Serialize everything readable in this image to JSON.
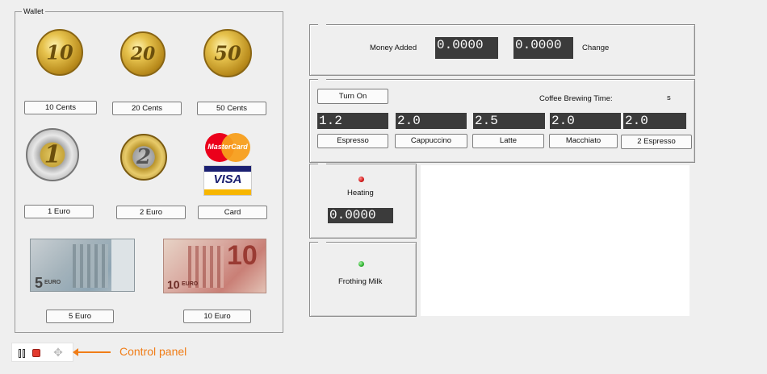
{
  "wallet": {
    "title": "Wallet",
    "coins": [
      {
        "label": "10 Cents",
        "face": "10"
      },
      {
        "label": "20 Cents",
        "face": "20"
      },
      {
        "label": "50 Cents",
        "face": "50"
      },
      {
        "label": "1 Euro",
        "face": "1"
      },
      {
        "label": "2 Euro",
        "face": "2"
      },
      {
        "label": "Card",
        "face": ""
      }
    ],
    "card_logos": {
      "mastercard": "MasterCard",
      "visa": "VISA"
    },
    "notes": [
      {
        "label": "5 Euro",
        "face": "5",
        "euro": "EURO"
      },
      {
        "label": "10 Euro",
        "face": "10",
        "euro": "EURO"
      }
    ]
  },
  "money": {
    "added_label": "Money Added",
    "added_value": "0.0000",
    "change_value": "0.0000",
    "change_label": "Change"
  },
  "brew": {
    "turn_on_label": "Turn On",
    "time_label": "Coffee Brewing Time:",
    "time_unit": "s",
    "drinks": [
      {
        "value": "1.2",
        "label": "Espresso"
      },
      {
        "value": "2.0",
        "label": "Cappuccino"
      },
      {
        "value": "2.5",
        "label": "Latte"
      },
      {
        "value": "2.0",
        "label": "Macchiato"
      },
      {
        "value": "2.0",
        "label": "2 Espresso"
      }
    ]
  },
  "heating": {
    "label": "Heating",
    "value": "0.0000",
    "led_color": "#d11a1a"
  },
  "frothing": {
    "label": "Frothing Milk",
    "led_color": "#2fb32f"
  },
  "control": {
    "label": "Control panel",
    "accent": "#f07d17"
  }
}
